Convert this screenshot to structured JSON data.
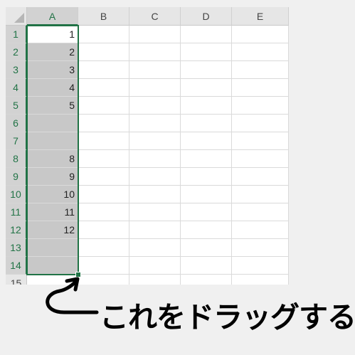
{
  "columns": [
    "A",
    "B",
    "C",
    "D",
    "E"
  ],
  "rows": [
    "1",
    "2",
    "3",
    "4",
    "5",
    "6",
    "7",
    "8",
    "9",
    "10",
    "11",
    "12",
    "13",
    "14",
    "15"
  ],
  "column_a_values": [
    "1",
    "2",
    "3",
    "4",
    "5",
    "",
    "",
    "8",
    "9",
    "10",
    "11",
    "12",
    "",
    "",
    ""
  ],
  "selection": {
    "range": "A1:A14",
    "active_cell": "A1"
  },
  "caption": "これをドラッグする",
  "colors": {
    "selection_border": "#217346",
    "selected_fill": "#c8c8c8"
  },
  "icons": [
    "fill-handle-icon",
    "curved-arrow-icon"
  ]
}
